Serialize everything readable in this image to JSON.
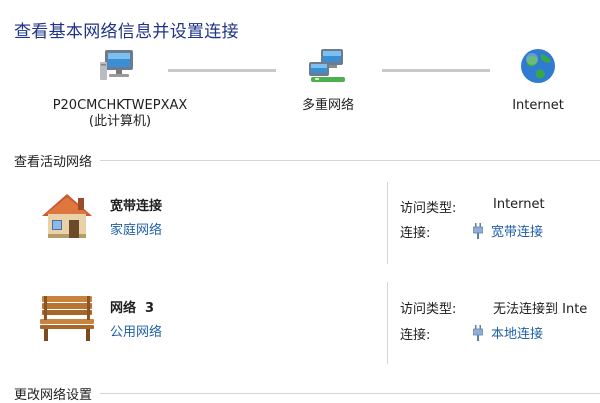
{
  "page": {
    "title": "查看基本网络信息并设置连接"
  },
  "map": {
    "computer": {
      "name": "P20CMCHKTWEPXAX",
      "sub": "(此计算机)",
      "icon": "computer-icon"
    },
    "multi": {
      "name": "多重网络",
      "icon": "network-icon"
    },
    "internet": {
      "name": "Internet",
      "icon": "globe-icon"
    }
  },
  "active": {
    "header": "查看活动网络",
    "networks": [
      {
        "name": "宽带连接",
        "type": "家庭网络",
        "icon": "home-icon",
        "access_label": "访问类型:",
        "access_value": "Internet",
        "conn_label": "连接:",
        "conn_value": "宽带连接"
      },
      {
        "name": "网络  3",
        "type": "公用网络",
        "icon": "bench-icon",
        "access_label": "访问类型:",
        "access_value": "无法连接到 Inte",
        "conn_label": "连接:",
        "conn_value": "本地连接"
      }
    ]
  },
  "change": {
    "header": "更改网络设置"
  },
  "colors": {
    "title": "#1e3287",
    "link": "#1f5fa8"
  }
}
